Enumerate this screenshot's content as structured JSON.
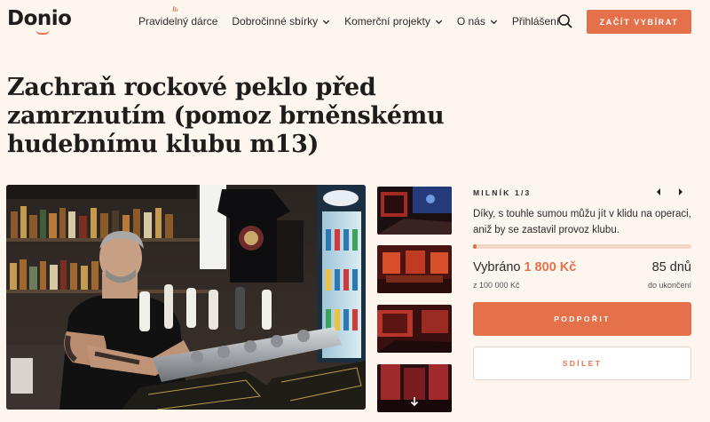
{
  "header": {
    "logo": "Donio",
    "nav": [
      {
        "label": "Pravidelný dárce",
        "dropdown": false
      },
      {
        "label": "Dobročinné sbírky",
        "dropdown": true
      },
      {
        "label": "Komerční projekty",
        "dropdown": true
      },
      {
        "label": "O nás",
        "dropdown": true
      },
      {
        "label": "Přihlášení",
        "dropdown": false
      }
    ],
    "cta_label": "ZAČÍT VYBÍRAT"
  },
  "campaign": {
    "title": "Zachraň rockové peklo před zamrznutím (pomoz brněnskému hudebnímu klubu m13)"
  },
  "gallery": {
    "thumbnail_count": 4
  },
  "milestone": {
    "label": "MILNÍK 1/3",
    "description": "Díky, s touhle sumou můžu jít v klidu na operaci, aniž by se zastavil provoz klubu."
  },
  "funding": {
    "raised_label": "Vybráno",
    "raised_amount": "1 800 Kč",
    "goal_text": "z  100 000 Kč",
    "progress_fraction": 0.018,
    "days_left": "85 dnů",
    "days_label": "do ukončení"
  },
  "actions": {
    "support_label": "PODPOŘIT",
    "share_label": "SDÍLET"
  },
  "colors": {
    "accent": "#e5714a",
    "background": "#fdf6ef",
    "progress_track": "#f3d7c6"
  },
  "icons": [
    "search-icon",
    "chevron-down-icon",
    "chevron-left-icon",
    "chevron-right-icon",
    "arrow-down-icon"
  ]
}
